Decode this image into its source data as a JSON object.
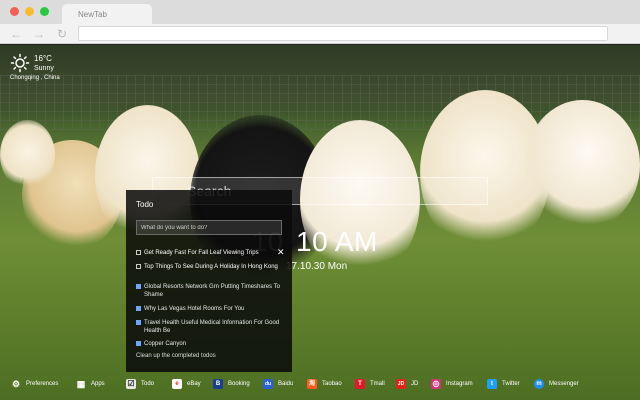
{
  "browser": {
    "tab_title": "NewTab",
    "back_glyph": "←",
    "forward_glyph": "→",
    "reload_glyph": "↻"
  },
  "weather": {
    "temperature": "16°C",
    "condition": "Sunny",
    "location": "Chongqing , China",
    "icon": "sun-icon"
  },
  "search": {
    "label": "Search"
  },
  "clock": {
    "faint_prefix": "10",
    "time": "10 AM",
    "date": "17.10.30 Mon"
  },
  "todo": {
    "title": "Todo",
    "input_placeholder": "What do you want to do?",
    "items": [
      {
        "text": "Get Ready Fast For Fall Leaf Viewing Trips",
        "done": false
      },
      {
        "text": "Top Things To See During A Holiday In Hong Kong",
        "done": false
      },
      {
        "text": "Global Resorts Network Grn Putting Timeshares To Shame",
        "done": true
      },
      {
        "text": "Why Las Vegas Hotel Rooms For You",
        "done": true
      },
      {
        "text": "Travel Health Useful Medical Information For Good Health Be",
        "done": true
      },
      {
        "text": "Copper Canyon",
        "done": true
      }
    ],
    "close_glyph": "✕",
    "clear_label": "Clean up the completed todos"
  },
  "bottom_bar": {
    "items": [
      {
        "label": "Preferences",
        "icon": "gear-icon",
        "color": "transparent",
        "glyph": "⚙"
      },
      {
        "label": "Apps",
        "icon": "apps-grid-icon",
        "color": "transparent",
        "glyph": "▦"
      },
      {
        "label": "Todo",
        "icon": "checkbox-icon",
        "color": "#e9e9e9",
        "glyph": "☑"
      },
      {
        "label": "eBay",
        "icon": "ebay-icon",
        "color": "#ffffff",
        "glyph": "e"
      },
      {
        "label": "Booking",
        "icon": "booking-icon",
        "color": "#1b3f8f",
        "glyph": "B"
      },
      {
        "label": "Baidu",
        "icon": "baidu-icon",
        "color": "#2a62d6",
        "glyph": "du"
      },
      {
        "label": "Taobao",
        "icon": "taobao-icon",
        "color": "#ff5a1f",
        "glyph": "淘"
      },
      {
        "label": "Tmall",
        "icon": "tmall-icon",
        "color": "#e01a2b",
        "glyph": "T"
      },
      {
        "label": "JD",
        "icon": "jd-icon",
        "color": "#e1251b",
        "glyph": "JD"
      },
      {
        "label": "Instagram",
        "icon": "instagram-icon",
        "color": "#d6307a",
        "glyph": "◎"
      },
      {
        "label": "Twitter",
        "icon": "twitter-icon",
        "color": "#1da1f2",
        "glyph": "t"
      },
      {
        "label": "Messenger",
        "icon": "messenger-icon",
        "color": "#1f8ff0",
        "glyph": "m"
      }
    ]
  }
}
